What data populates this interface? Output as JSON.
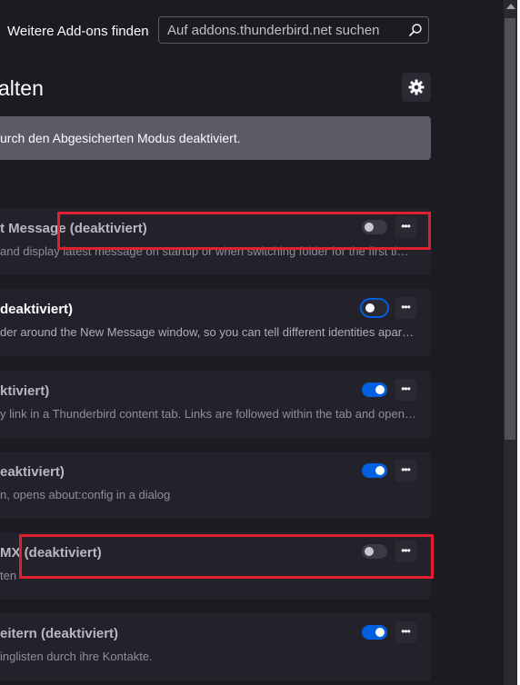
{
  "header": {
    "find_addons_label": "Weitere Add-ons finden",
    "search_placeholder": "Auf addons.thunderbird.net suchen",
    "search_icon": "search-icon"
  },
  "page": {
    "heading": "alten",
    "settings_icon": "gear-icon"
  },
  "banner": {
    "text": "urch den Abgesicherten Modus deaktiviert."
  },
  "addons": [
    {
      "title": "t Message (deaktiviert)",
      "desc": "and display latest message on startup or when switching folder for the first time in a session.",
      "enabled": false,
      "highlighted": true
    },
    {
      "title": "deaktiviert)",
      "desc": "der around the New Message window, so you can tell different identities apart at a glance.",
      "enabled": false,
      "focused": true
    },
    {
      "title": "ktiviert)",
      "desc": "y link in a Thunderbird content tab. Links are followed within the tab and opened in the browser.",
      "enabled": true
    },
    {
      "title": "eaktiviert)",
      "desc": "n, opens about:config in a dialog",
      "enabled": true
    },
    {
      "title": "MX (deaktiviert)",
      "desc": "ten",
      "enabled": false,
      "highlighted": true
    },
    {
      "title": "eitern (deaktiviert)",
      "desc": "inglisten durch ihre Kontakte.",
      "enabled": true
    }
  ],
  "colors": {
    "accent": "#0060df",
    "highlight_box": "#e02030",
    "background": "#1c1b22",
    "card": "#23222b"
  }
}
